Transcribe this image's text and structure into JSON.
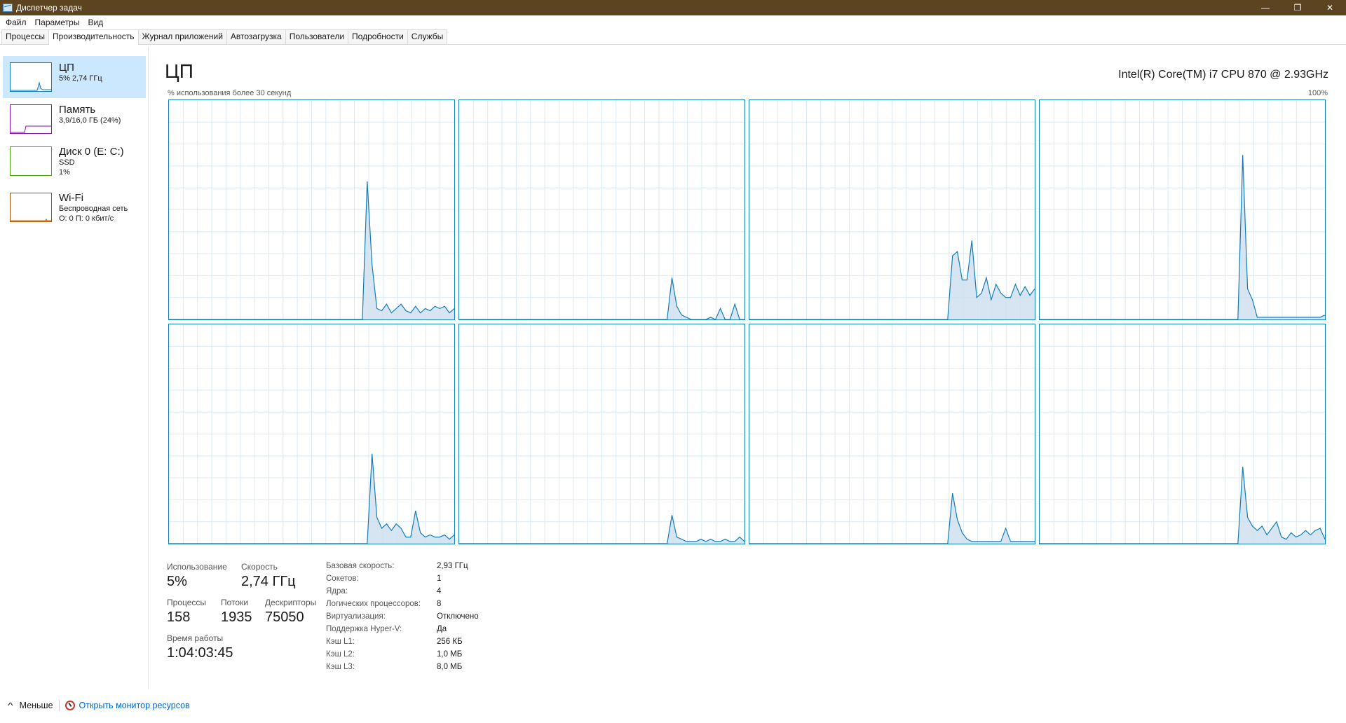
{
  "window": {
    "title": "Диспетчер задач",
    "min_glyph": "—",
    "max_glyph": "❐",
    "close_glyph": "✕"
  },
  "menu": [
    "Файл",
    "Параметры",
    "Вид"
  ],
  "tabs": [
    "Процессы",
    "Производительность",
    "Журнал приложений",
    "Автозагрузка",
    "Пользователи",
    "Подробности",
    "Службы"
  ],
  "active_tab": "Производительность",
  "sidebar": {
    "items": [
      {
        "name": "ЦП",
        "line1": "5% 2,74 ГГц",
        "line2": "",
        "color": "#117dbb",
        "active": true
      },
      {
        "name": "Память",
        "line1": "3,9/16,0 ГБ (24%)",
        "line2": "",
        "color": "#8b12ae",
        "active": false
      },
      {
        "name": "Диск 0 (E: C:)",
        "line1": "SSD",
        "line2": "1%",
        "color": "#4da60c",
        "active": false
      },
      {
        "name": "Wi-Fi",
        "line1": "Беспроводная сеть",
        "line2": "О: 0 П: 0 кбит/с",
        "color": "#a74f01",
        "active": false
      }
    ]
  },
  "main": {
    "title": "ЦП",
    "cpu_model": "Intel(R) Core(TM) i7 CPU 870 @ 2.93GHz",
    "usage_caption": "% использования более 30 секунд",
    "max_label": "100%"
  },
  "colors": {
    "graph_line": "#117dbb",
    "graph_fill": "#cfe1ee",
    "grid": "#d9eaf4",
    "accent_selected": "#cce8ff"
  },
  "stats": {
    "usage": {
      "label": "Использование",
      "value": "5%"
    },
    "speed": {
      "label": "Скорость",
      "value": "2,74 ГГц"
    },
    "processes": {
      "label": "Процессы",
      "value": "158"
    },
    "threads": {
      "label": "Потоки",
      "value": "1935"
    },
    "handles": {
      "label": "Дескрипторы",
      "value": "75050"
    },
    "uptime": {
      "label": "Время работы",
      "value": "1:04:03:45"
    }
  },
  "specs": [
    {
      "k": "Базовая скорость:",
      "v": "2,93 ГГц"
    },
    {
      "k": "Сокетов:",
      "v": "1"
    },
    {
      "k": "Ядра:",
      "v": "4"
    },
    {
      "k": "Логических процессоров:",
      "v": "8"
    },
    {
      "k": "Виртуализация:",
      "v": "Отключено"
    },
    {
      "k": "Поддержка Hyper-V:",
      "v": "Да"
    },
    {
      "k": "Кэш L1:",
      "v": "256 КБ"
    },
    {
      "k": "Кэш L2:",
      "v": "1,0 МБ"
    },
    {
      "k": "Кэш L3:",
      "v": "8,0 МБ"
    }
  ],
  "footer": {
    "fewer_label": "Меньше",
    "monitor_label": "Открыть монитор ресурсов"
  },
  "chart_data": {
    "type": "area",
    "title": "ЦП",
    "ylabel": "% использования более 30 секунд",
    "ylim": [
      0,
      100
    ],
    "x": [
      0,
      1,
      2,
      3,
      4,
      5,
      6,
      7,
      8,
      9,
      10,
      11,
      12,
      13,
      14,
      15,
      16,
      17,
      18,
      19,
      20,
      21,
      22,
      23,
      24,
      25,
      26,
      27,
      28,
      29,
      30,
      31,
      32,
      33,
      34,
      35,
      36,
      37,
      38,
      39,
      40,
      41,
      42,
      43,
      44,
      45,
      46,
      47,
      48,
      49,
      50,
      51,
      52,
      53,
      54,
      55,
      56,
      57,
      58,
      59
    ],
    "series": [
      {
        "values": [
          0,
          0,
          0,
          0,
          0,
          0,
          0,
          0,
          0,
          0,
          0,
          0,
          0,
          0,
          0,
          0,
          0,
          0,
          0,
          0,
          0,
          0,
          0,
          0,
          0,
          0,
          0,
          0,
          0,
          0,
          0,
          0,
          0,
          0,
          0,
          0,
          0,
          0,
          0,
          0,
          0,
          63,
          25,
          5,
          4,
          7,
          3,
          5,
          7,
          4,
          3,
          6,
          3,
          5,
          4,
          6,
          5,
          6,
          3,
          5
        ]
      },
      {
        "values": [
          0,
          0,
          0,
          0,
          0,
          0,
          0,
          0,
          0,
          0,
          0,
          0,
          0,
          0,
          0,
          0,
          0,
          0,
          0,
          0,
          0,
          0,
          0,
          0,
          0,
          0,
          0,
          0,
          0,
          0,
          0,
          0,
          0,
          0,
          0,
          0,
          0,
          0,
          0,
          0,
          0,
          0,
          0,
          0,
          19,
          6,
          2,
          1,
          0,
          0,
          0,
          0,
          1,
          0,
          5,
          0,
          0,
          7,
          0,
          0
        ]
      },
      {
        "values": [
          0,
          0,
          0,
          0,
          0,
          0,
          0,
          0,
          0,
          0,
          0,
          0,
          0,
          0,
          0,
          0,
          0,
          0,
          0,
          0,
          0,
          0,
          0,
          0,
          0,
          0,
          0,
          0,
          0,
          0,
          0,
          0,
          0,
          0,
          0,
          0,
          0,
          0,
          0,
          0,
          0,
          0,
          29,
          31,
          18,
          18,
          36,
          10,
          12,
          19,
          9,
          16,
          12,
          10,
          10,
          16,
          11,
          15,
          11,
          14
        ]
      },
      {
        "values": [
          0,
          0,
          0,
          0,
          0,
          0,
          0,
          0,
          0,
          0,
          0,
          0,
          0,
          0,
          0,
          0,
          0,
          0,
          0,
          0,
          0,
          0,
          0,
          0,
          0,
          0,
          0,
          0,
          0,
          0,
          0,
          0,
          0,
          0,
          0,
          0,
          0,
          0,
          0,
          0,
          0,
          0,
          75,
          14,
          9,
          1,
          1,
          1,
          1,
          1,
          1,
          1,
          1,
          1,
          1,
          1,
          1,
          1,
          1,
          2
        ]
      },
      {
        "values": [
          0,
          0,
          0,
          0,
          0,
          0,
          0,
          0,
          0,
          0,
          0,
          0,
          0,
          0,
          0,
          0,
          0,
          0,
          0,
          0,
          0,
          0,
          0,
          0,
          0,
          0,
          0,
          0,
          0,
          0,
          0,
          0,
          0,
          0,
          0,
          0,
          0,
          0,
          0,
          0,
          0,
          0,
          41,
          12,
          7,
          9,
          6,
          9,
          7,
          3,
          3,
          15,
          5,
          3,
          4,
          3,
          3,
          4,
          2,
          4
        ]
      },
      {
        "values": [
          0,
          0,
          0,
          0,
          0,
          0,
          0,
          0,
          0,
          0,
          0,
          0,
          0,
          0,
          0,
          0,
          0,
          0,
          0,
          0,
          0,
          0,
          0,
          0,
          0,
          0,
          0,
          0,
          0,
          0,
          0,
          0,
          0,
          0,
          0,
          0,
          0,
          0,
          0,
          0,
          0,
          0,
          0,
          0,
          13,
          3,
          2,
          1,
          1,
          1,
          2,
          1,
          2,
          1,
          1,
          2,
          1,
          1,
          3,
          1
        ]
      },
      {
        "values": [
          0,
          0,
          0,
          0,
          0,
          0,
          0,
          0,
          0,
          0,
          0,
          0,
          0,
          0,
          0,
          0,
          0,
          0,
          0,
          0,
          0,
          0,
          0,
          0,
          0,
          0,
          0,
          0,
          0,
          0,
          0,
          0,
          0,
          0,
          0,
          0,
          0,
          0,
          0,
          0,
          0,
          0,
          23,
          11,
          5,
          2,
          1,
          1,
          1,
          1,
          1,
          1,
          1,
          7,
          1,
          1,
          1,
          1,
          1,
          1
        ]
      },
      {
        "values": [
          0,
          0,
          0,
          0,
          0,
          0,
          0,
          0,
          0,
          0,
          0,
          0,
          0,
          0,
          0,
          0,
          0,
          0,
          0,
          0,
          0,
          0,
          0,
          0,
          0,
          0,
          0,
          0,
          0,
          0,
          0,
          0,
          0,
          0,
          0,
          0,
          0,
          0,
          0,
          0,
          0,
          0,
          35,
          12,
          8,
          6,
          8,
          4,
          7,
          10,
          3,
          2,
          5,
          3,
          4,
          6,
          4,
          6,
          7,
          2
        ]
      }
    ]
  }
}
